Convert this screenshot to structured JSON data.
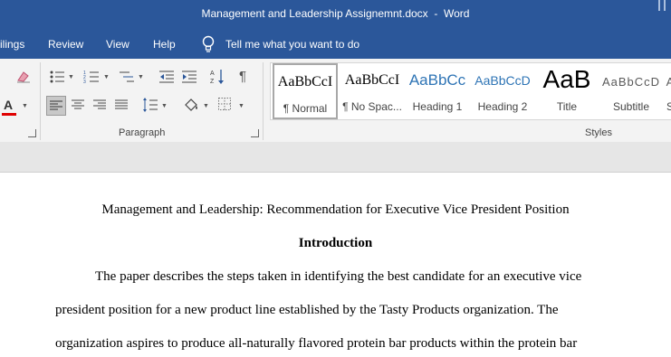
{
  "window": {
    "title": "Management and Leadership Assignemnt.docx  -  Word"
  },
  "menubar": {
    "tabs": [
      "ilings",
      "Review",
      "View",
      "Help"
    ],
    "tell_me": "Tell me what you want to do"
  },
  "ribbon": {
    "paragraph_group_label": "Paragraph",
    "styles_group_label": "Styles",
    "styles": [
      {
        "sample": "AaBbCcI",
        "name": "¶ Normal"
      },
      {
        "sample": "AaBbCcI",
        "name": "¶ No Spac..."
      },
      {
        "sample": "AaBbCc",
        "name": "Heading 1"
      },
      {
        "sample": "AaBbCcD",
        "name": "Heading 2"
      },
      {
        "sample": "AaB",
        "name": "Title"
      },
      {
        "sample": "AaBbCcD",
        "name": "Subtitle"
      }
    ]
  },
  "colors": {
    "title_bar": "#2b579a",
    "font_color_underline": "#e00000",
    "heading_blue": "#2e74b5"
  },
  "document": {
    "title": "Management and Leadership: Recommendation for Executive Vice President Position",
    "heading": "Introduction",
    "lines": [
      "The paper describes the steps taken in identifying the best candidate for an executive vice",
      "president position for a new product line established by the Tasty Products organization. The",
      "organization aspires to produce all-naturally flavored protein bar products within the protein bar"
    ]
  }
}
